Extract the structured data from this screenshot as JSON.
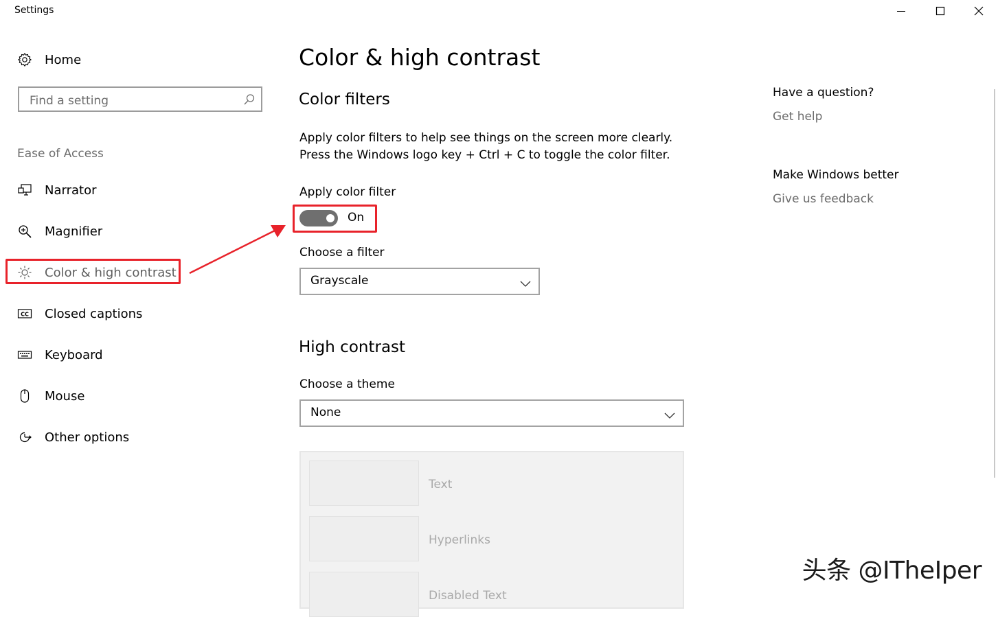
{
  "window": {
    "title": "Settings",
    "controls": [
      "minimize",
      "maximize",
      "close"
    ]
  },
  "sidebar": {
    "home_label": "Home",
    "search_placeholder": "Find a setting",
    "section_label": "Ease of Access",
    "items": [
      {
        "label": "Narrator",
        "icon": "narrator-icon"
      },
      {
        "label": "Magnifier",
        "icon": "magnifier-icon"
      },
      {
        "label": "Color & high contrast",
        "icon": "brightness-icon",
        "selected": true
      },
      {
        "label": "Closed captions",
        "icon": "closed-captions-icon"
      },
      {
        "label": "Keyboard",
        "icon": "keyboard-icon"
      },
      {
        "label": "Mouse",
        "icon": "mouse-icon"
      },
      {
        "label": "Other options",
        "icon": "other-options-icon"
      }
    ]
  },
  "main": {
    "title": "Color & high contrast",
    "color_filters": {
      "heading": "Color filters",
      "description_line1": "Apply color filters to help see things on the screen more clearly.",
      "description_line2": "Press the Windows logo key + Ctrl + C to toggle the color filter.",
      "toggle_label": "Apply color filter",
      "toggle_state": "On",
      "toggle_on": true,
      "filter_label": "Choose a filter",
      "filter_value": "Grayscale"
    },
    "high_contrast": {
      "heading": "High contrast",
      "theme_label": "Choose a theme",
      "theme_value": "None",
      "preview_labels": [
        "Text",
        "Hyperlinks",
        "Disabled Text"
      ]
    }
  },
  "right_rail": {
    "question_heading": "Have a question?",
    "get_help_link": "Get help",
    "feedback_heading": "Make Windows better",
    "feedback_link": "Give us feedback"
  },
  "colors": {
    "annotation_red": "#e8222a",
    "toggle_on": "#6f6f6f",
    "link_gray": "#6d6d6d"
  },
  "watermark": "头条 @ITheIper"
}
